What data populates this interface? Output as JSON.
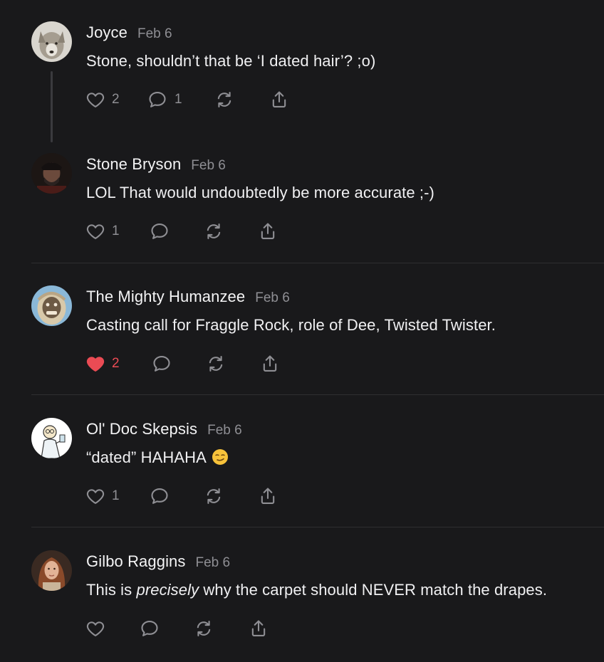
{
  "comments": [
    {
      "author": "Joyce",
      "date": "Feb 6",
      "text": "Stone, shouldn’t that be ‘I dated hair’? ;o)",
      "likes": "2",
      "replies": "1",
      "liked": false
    },
    {
      "author": "Stone Bryson",
      "date": "Feb 6",
      "text": "LOL That would undoubtedly be more accurate ;-)",
      "likes": "1",
      "replies": "",
      "liked": false
    },
    {
      "author": "The Mighty Humanzee",
      "date": "Feb 6",
      "text": "Casting call for Fraggle Rock, role of Dee, Twisted Twister.",
      "likes": "2",
      "replies": "",
      "liked": true
    },
    {
      "author": "Ol' Doc Skepsis",
      "date": "Feb 6",
      "text": "“dated” HAHAHA",
      "emoji": "smirking-face",
      "likes": "1",
      "replies": "",
      "liked": false
    },
    {
      "author": "Gilbo Raggins",
      "date": "Feb 6",
      "text_before": "This is ",
      "text_em": "precisely",
      "text_after": " why the carpet should NEVER match the drapes.",
      "likes": "",
      "replies": "",
      "liked": false
    }
  ],
  "colors": {
    "background": "#19191b",
    "muted": "#8f8f94",
    "like_active": "#ea4b54"
  }
}
